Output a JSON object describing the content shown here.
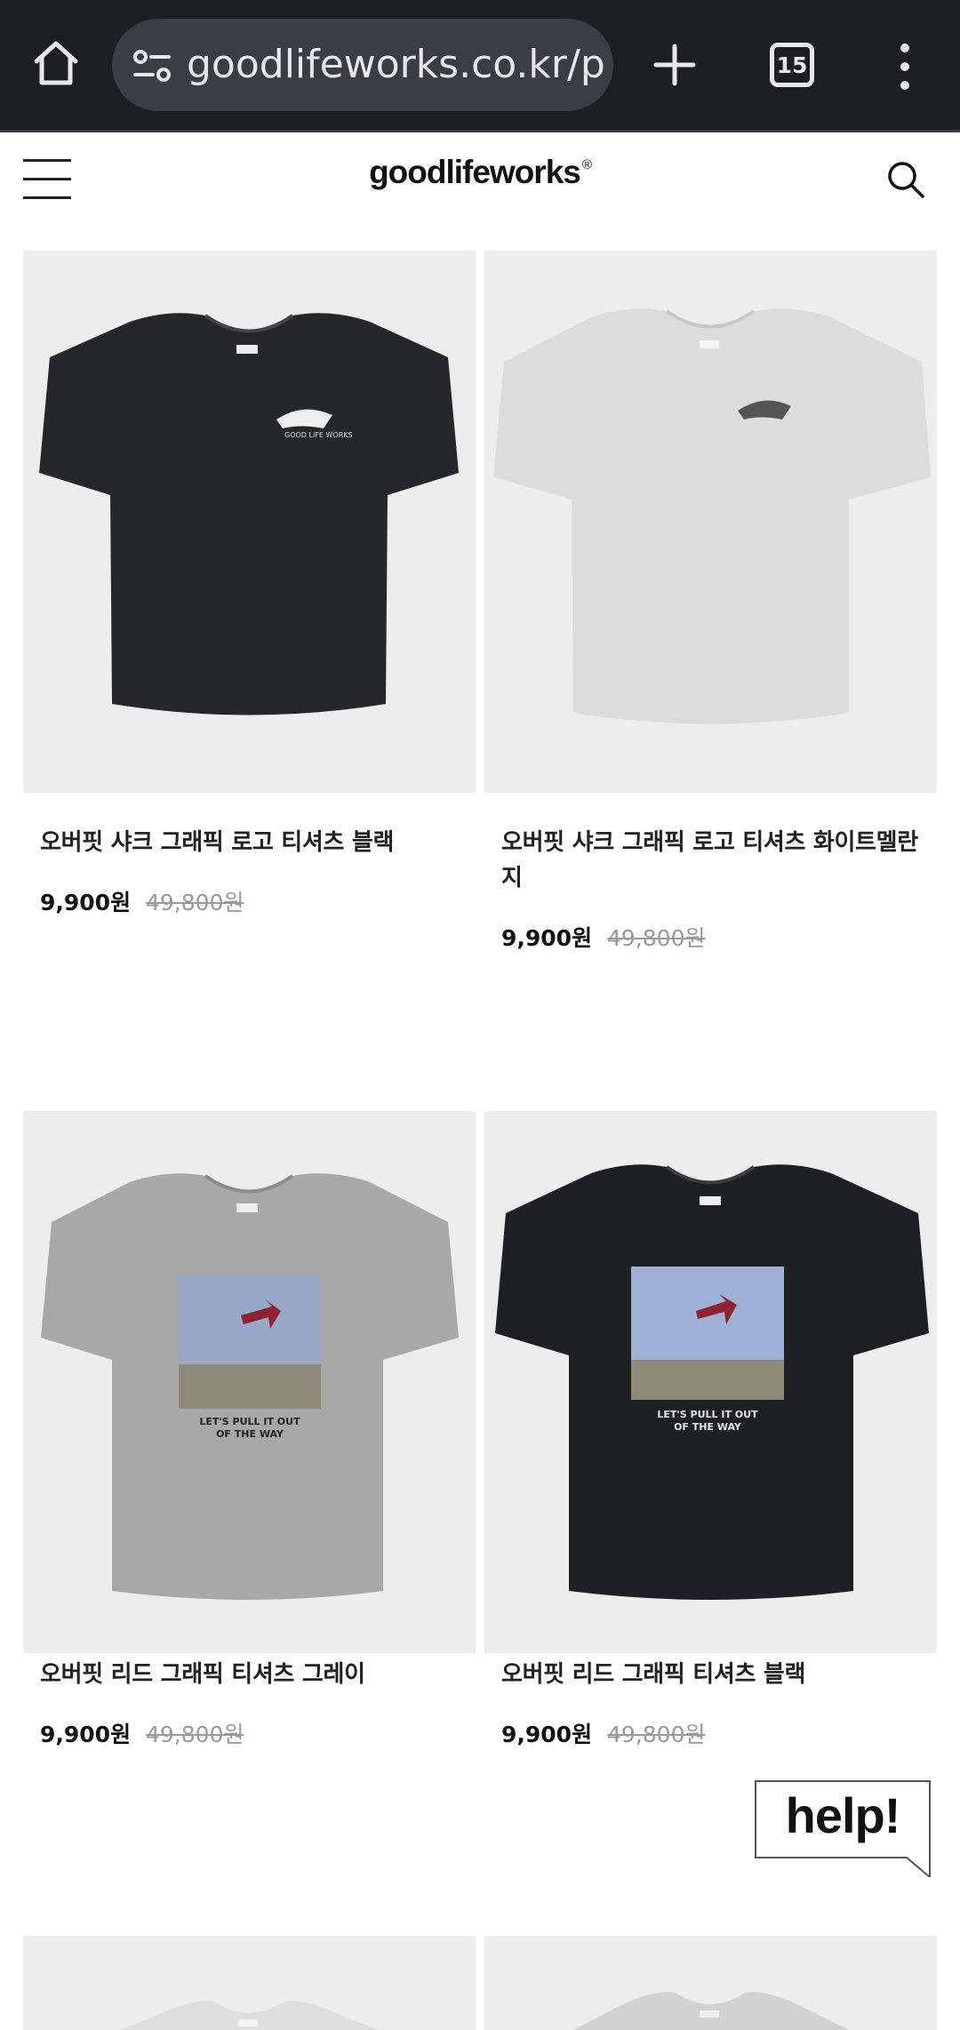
{
  "browser": {
    "url": "goodlifeworks.co.kr/p",
    "tab_count": "15",
    "icons": [
      "home-icon",
      "site-settings-icon",
      "new-tab-plus-icon",
      "tab-switcher-icon",
      "more-vert-icon"
    ]
  },
  "site": {
    "logo": "goodlifeworks",
    "logo_mark": "®",
    "icons": [
      "hamburger-menu-icon",
      "search-icon"
    ]
  },
  "products": [
    {
      "name": "오버핏 샤크 그래픽 로고 티셔츠 블랙",
      "name_line2": "",
      "price": "9,900원",
      "original_price": "49,800원",
      "shirt_color": "#26272b",
      "print": "shark"
    },
    {
      "name": "오버핏 샤크 그래픽 로고 티셔츠 화이트멜란",
      "name_line2": "지",
      "price": "9,900원",
      "original_price": "49,800원",
      "shirt_color": "#dcdcdc",
      "print": "shark"
    },
    {
      "name": "오버핏 리드 그래픽 티셔츠 그레이",
      "name_line2": "",
      "price": "9,900원",
      "original_price": "49,800원",
      "shirt_color": "#a8a8a8",
      "print": "photo"
    },
    {
      "name": "오버핏 리드 그래픽 티셔츠 블랙",
      "name_line2": "",
      "price": "9,900원",
      "original_price": "49,800원",
      "shirt_color": "#1f2024",
      "print": "photo"
    }
  ],
  "shirt_print_text": [
    "LET'S PULL IT OUT",
    "OF THE WAY"
  ],
  "help_widget": {
    "label": "help!"
  }
}
